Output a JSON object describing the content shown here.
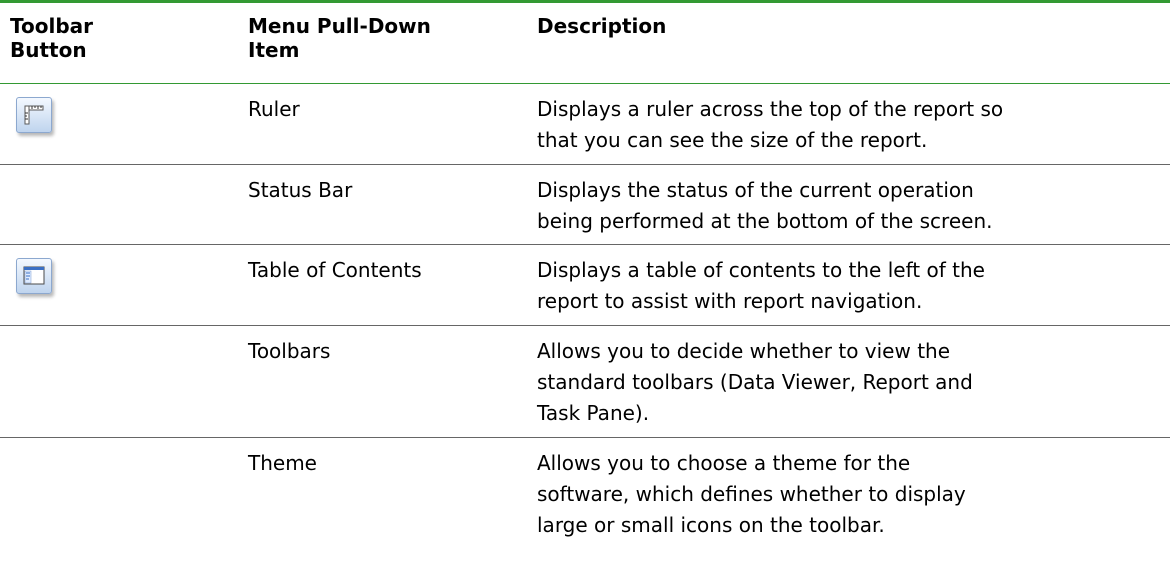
{
  "headers": {
    "toolbar_button": [
      "Toolbar",
      "Button"
    ],
    "menu_item": [
      "Menu Pull-Down",
      "Item"
    ],
    "description": "Description"
  },
  "rows": [
    {
      "icon": "ruler-icon",
      "menu_item": "Ruler",
      "description": [
        "Displays a ruler across the top of the report so",
        "that you can see the size of the report."
      ]
    },
    {
      "icon": "",
      "menu_item": "Status Bar",
      "description": [
        "Displays the status of the current operation",
        "being performed at the bottom of the screen."
      ]
    },
    {
      "icon": "table-of-contents-icon",
      "menu_item": "Table of Contents",
      "description": [
        "Displays a table of contents to the left of the",
        "report to assist with report navigation."
      ]
    },
    {
      "icon": "",
      "menu_item": "Toolbars",
      "description": [
        "Allows you to decide whether to view the",
        "standard toolbars (Data Viewer, Report and",
        "Task Pane)."
      ]
    },
    {
      "icon": "",
      "menu_item": "Theme",
      "description": [
        "Allows you to choose a theme for the",
        "software, which defines whether to display",
        "large or small icons on the toolbar."
      ]
    }
  ],
  "colors": {
    "header_rule": "#339933",
    "row_rule": "#666666",
    "icon_face": "#bfd4ee"
  }
}
